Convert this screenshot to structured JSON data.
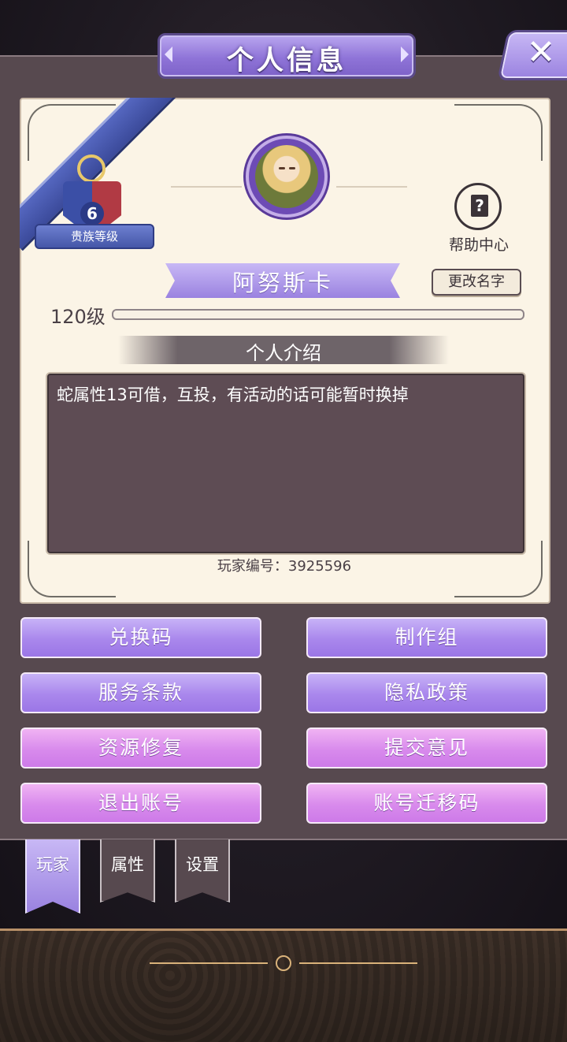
{
  "window": {
    "title": "个人信息",
    "close_glyph": "✕"
  },
  "profile": {
    "noble_level": "6",
    "noble_label": "贵族等级",
    "help_label": "帮助中心",
    "help_glyph": "?",
    "player_name": "阿努斯卡",
    "rename_label": "更改名字",
    "level_text": "120级",
    "level_progress": 0.0
  },
  "intro": {
    "header": "个人介绍",
    "text": "蛇属性13可借，互投，有活动的话可能暂时换掉",
    "player_id": "玩家编号：3925596"
  },
  "actions": {
    "redeem_code": "兑换码",
    "credits": "制作组",
    "terms": "服务条款",
    "privacy": "隐私政策",
    "repair": "资源修复",
    "feedback": "提交意见",
    "logout": "退出账号",
    "migration_code": "账号迁移码"
  },
  "tabs": [
    {
      "label": "玩家",
      "active": true
    },
    {
      "label": "属性",
      "active": false
    },
    {
      "label": "设置",
      "active": false
    }
  ],
  "colors": {
    "panel": "#57494f",
    "card": "#fbf4e6",
    "violet": "#a987ec",
    "pink": "#d88aec",
    "intro_box": "#5e4c54"
  },
  "icons": {
    "close": "close-icon",
    "help": "help-book-icon",
    "avatar": "avatar-portrait"
  }
}
